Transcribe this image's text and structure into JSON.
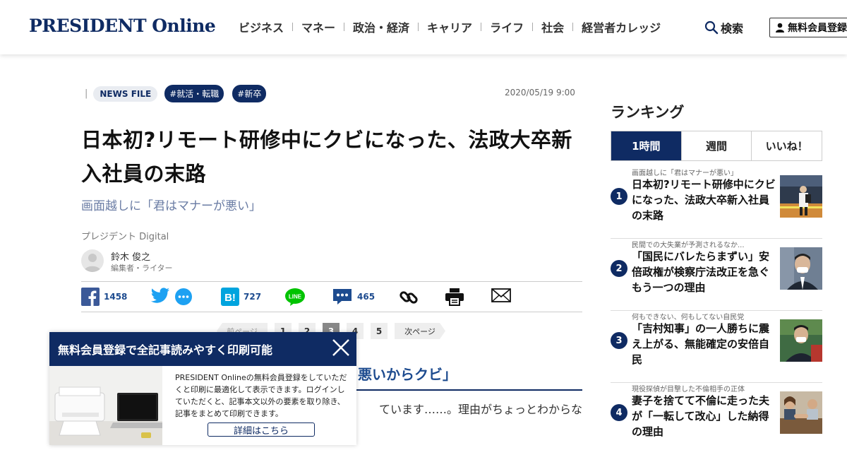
{
  "header": {
    "logo": "PRESIDENT Online",
    "nav": [
      "ビジネス",
      "マネー",
      "政治・経済",
      "キャリア",
      "ライフ",
      "社会",
      "経営者カレッジ"
    ],
    "search_label": "検索",
    "member_label": "無料会員登録"
  },
  "article": {
    "category": "NEWS FILE",
    "tags": [
      "#就活・転職",
      "#新卒"
    ],
    "date": "2020/05/19 9:00",
    "title": "日本初?リモート研修中にクビになった、法政大卒新入社員の末路",
    "subtitle": "画面越しに「君はマナーが悪い」",
    "publisher": "プレジデント Digital",
    "author_name": "鈴木 俊之",
    "author_role": "編集者・ライター"
  },
  "share": {
    "facebook_count": "1458",
    "hatena_count": "727",
    "comment_count": "465"
  },
  "pager": {
    "prev_label": "前ページ",
    "pages": [
      "1",
      "2",
      "3",
      "4",
      "5"
    ],
    "current": "3",
    "next_label": "次ページ"
  },
  "content": {
    "section_heading": "悪いからクビ」",
    "body_snippet": "ています……。理由がちょっとわからな"
  },
  "popup": {
    "heading": "無料会員登録で全記事読みやすく印刷可能",
    "text": "PRESIDENT Onlineの無料会員登録をしていただくと印刷に最適化して表示できます。ログインしていただくと、記事本文以外の要素を取り除き、記事をまとめて印刷できます。",
    "button_label": "詳細はこちら"
  },
  "ranking": {
    "title": "ランキング",
    "tabs": [
      "1時間",
      "週間",
      "いいね！"
    ],
    "active_tab": "1時間",
    "items": [
      {
        "rank": "1",
        "kicker": "画面越しに「君はマナーが悪い」",
        "headline": "日本初?リモート研修中にクビになった、法政大卒新入社員の末路"
      },
      {
        "rank": "2",
        "kicker": "民間での大失業が予測されるなか...",
        "headline": "「国民にバレたらまずい」安倍政権が検察庁法改正を急ぐもう一つの理由"
      },
      {
        "rank": "3",
        "kicker": "何もできない、何もしてない自民党",
        "headline": "「吉村知事」の一人勝ちに震え上がる、無能確定の安倍自民"
      },
      {
        "rank": "4",
        "kicker": "現役探偵が目撃した不倫相手の正体",
        "headline": "妻子を捨てて不倫に走った夫が「一転して改心」した納得の理由"
      }
    ]
  },
  "colors": {
    "brand_navy": "#0f2b63",
    "link_blue": "#1d4b8f",
    "facebook": "#3b5998",
    "twitter": "#1da1f2",
    "hatena": "#00a4de",
    "line": "#00c300"
  }
}
